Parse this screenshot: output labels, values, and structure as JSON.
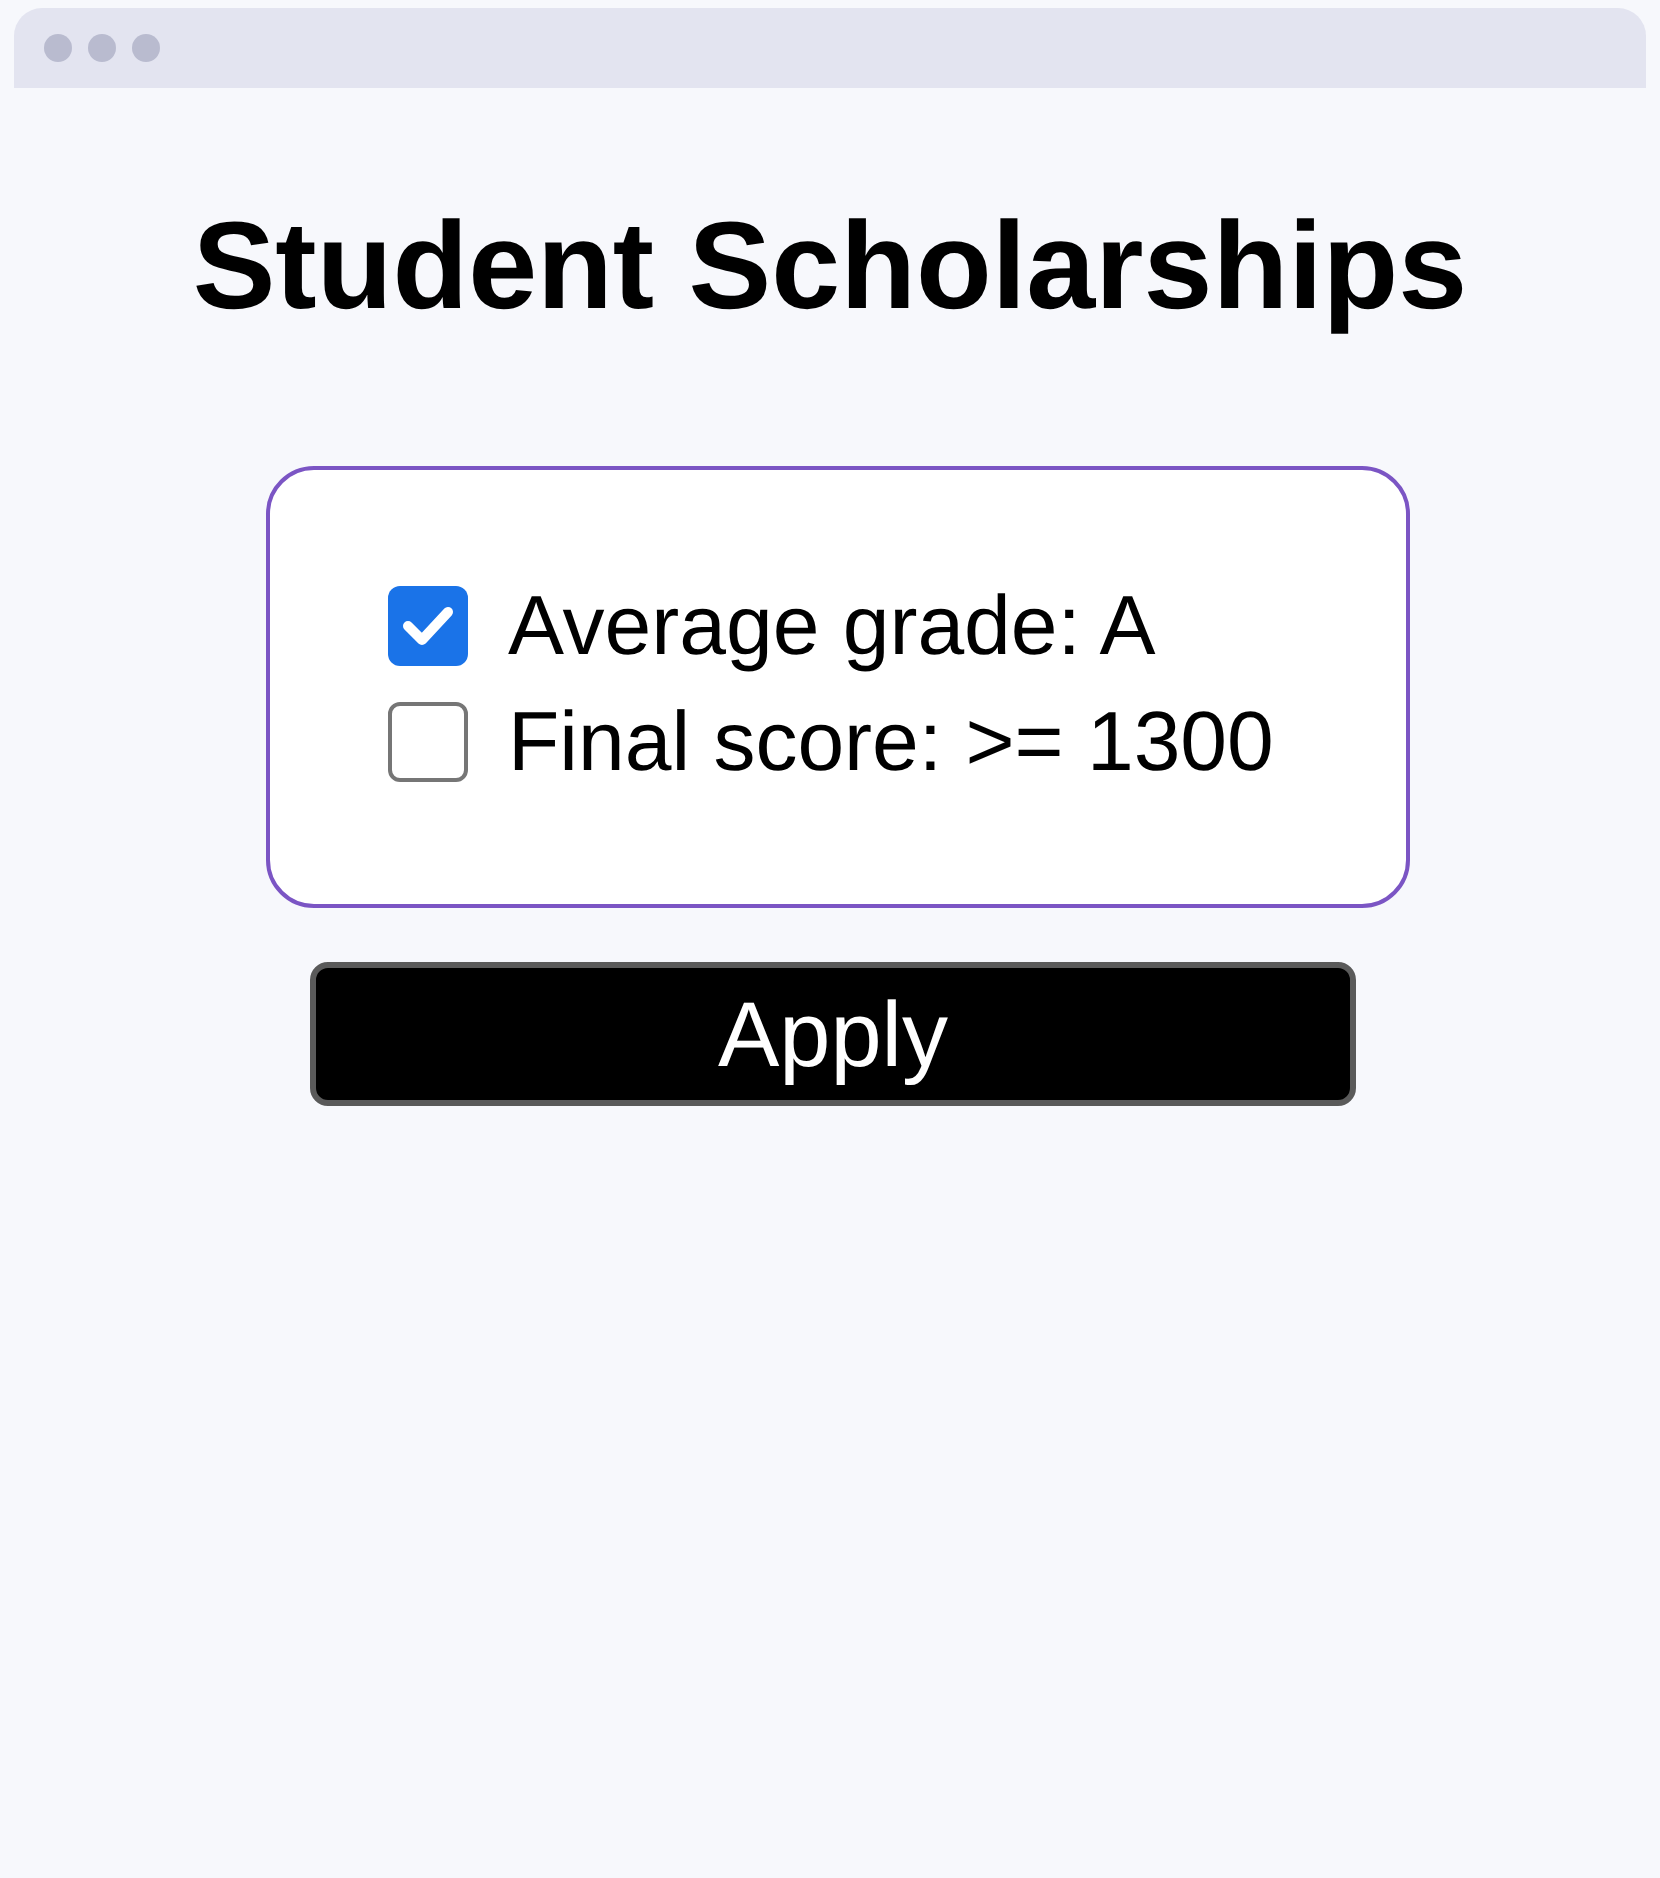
{
  "title": "Student Scholarships",
  "criteria": [
    {
      "label": "Average grade: A",
      "checked": true
    },
    {
      "label": "Final score: >= 1300",
      "checked": false
    }
  ],
  "button": {
    "label": "Apply"
  }
}
